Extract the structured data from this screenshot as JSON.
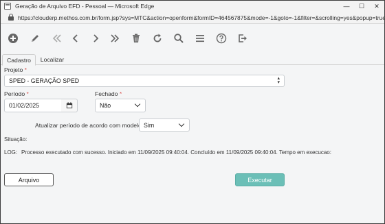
{
  "window": {
    "title": "Geração de Arquivo EFD - Pessoal — Microsoft Edge",
    "controls": {
      "minimize": "—",
      "maximize": "☐",
      "close": "✕"
    }
  },
  "address": {
    "url": "https://clouderp.methos.com.br/form.jsp?sys=MTC&action=openform&formID=464567875&mode=-1&goto=-1&filter=&scrolling=yes&popup=true"
  },
  "toolbar": {
    "icons": [
      "add-icon",
      "edit-icon",
      "first-icon",
      "previous-icon",
      "next-icon",
      "last-icon",
      "delete-icon",
      "refresh-icon",
      "search-icon",
      "menu-icon",
      "help-icon",
      "exit-icon"
    ]
  },
  "tabs": [
    {
      "label": "Cadastro",
      "active": true
    },
    {
      "label": "Localizar",
      "active": false
    }
  ],
  "form": {
    "projeto": {
      "label": "Projeto",
      "required_mark": "*",
      "value": "SPED - GERAÇÃO SPED"
    },
    "periodo": {
      "label": "Período",
      "required_mark": "*",
      "value": "01/02/2025"
    },
    "fechado": {
      "label": "Fechado",
      "required_mark": "*",
      "value": "Não"
    },
    "atualizar": {
      "label": "Atualizar período de acordo com modelo",
      "value": "Sim"
    },
    "situacao": {
      "label": "Situação:"
    },
    "log": {
      "label": "LOG:",
      "text": "Processo executado com sucesso. Iniciado em 11/09/2025 09:40:04. Concluído em 11/09/2025 09:40:04. Tempo em execucao:"
    }
  },
  "buttons": {
    "arquivo": "Arquivo",
    "executar": "Executar"
  },
  "colors": {
    "accent": "#6bbfb7",
    "required": "#d9534f",
    "icon": "#666666"
  }
}
